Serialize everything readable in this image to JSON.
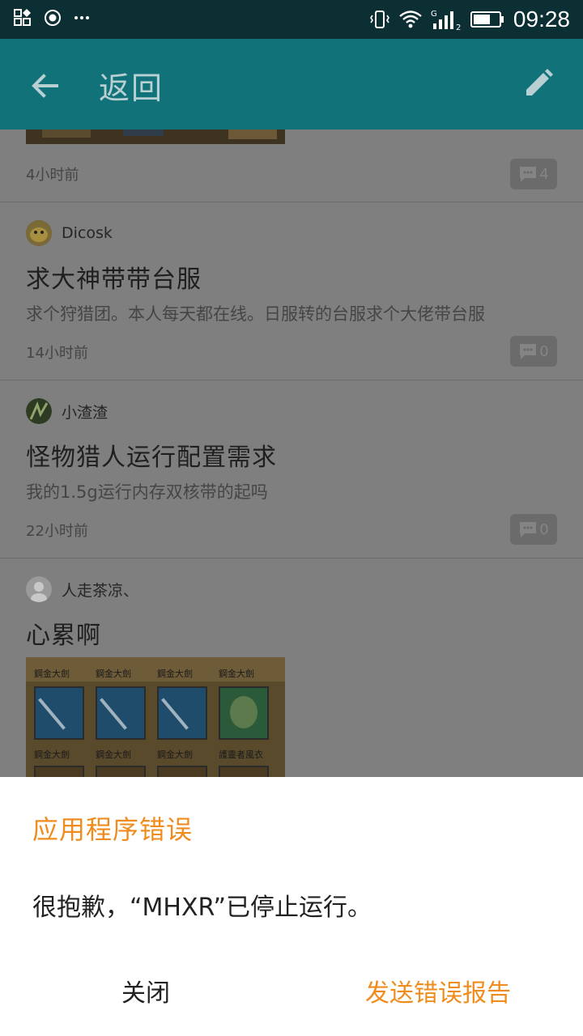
{
  "status_bar": {
    "time": "09:28",
    "icons_left": [
      "app-grid-icon",
      "record-icon",
      "more-dots-icon"
    ],
    "icons_right": [
      "vibrate-icon",
      "wifi-icon",
      "signal-icon",
      "battery-icon"
    ],
    "signal_label": "G",
    "sim_index": "2"
  },
  "app_bar": {
    "title": "返回",
    "back_icon": "arrow-left-icon",
    "edit_icon": "pencil-icon",
    "color": "#11727a"
  },
  "posts": [
    {
      "time": "4小时前",
      "comments": "4"
    },
    {
      "author": "Dicosk",
      "title": "求大神带带台服",
      "excerpt": "求个狩猎团。本人每天都在线。日服转的台服求个大佬带台服",
      "time": "14小时前",
      "comments": "0"
    },
    {
      "author": "小渣渣",
      "title": "怪物猎人运行配置需求",
      "excerpt": "我的1.5g运行内存双核带的起吗",
      "time": "22小时前",
      "comments": "0"
    },
    {
      "author": "人走茶凉、",
      "title": "心累啊",
      "image_labels": [
        "鋼金大劍",
        "鋼金大劍",
        "鋼金大劍",
        "鋼金大劍",
        "鋼金大劍",
        "鋼金大劍",
        "鋼金大劍",
        "護靈者風衣"
      ]
    }
  ],
  "dialog": {
    "title": "应用程序错误",
    "message": "很抱歉，“MHXR”已停止运行。",
    "close_label": "关闭",
    "report_label": "发送错误报告",
    "accent_color": "#f08c1e"
  }
}
